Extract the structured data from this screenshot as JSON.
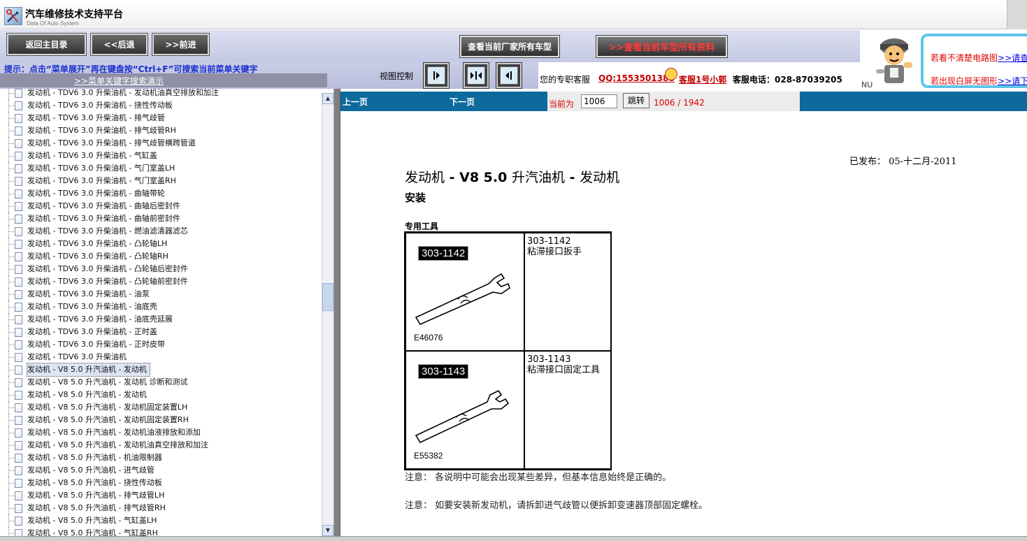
{
  "app": {
    "title": "汽车维修技术支持平台",
    "subtitle": "Data Of Auto System"
  },
  "toolbar": {
    "home_label": "返回主目录",
    "back_label": "<<后退",
    "forward_label": ">>前进",
    "all_models_label": "查看当前厂家所有车型",
    "current_model_label": ">>查看当前车型所有资料"
  },
  "hint": {
    "text": "提示：点击“菜单展开”再在键盘按“Ctrl+F”可搜索当前菜单关键字",
    "link": ">>菜单关键字搜索演示"
  },
  "view_control": {
    "label": "视图控制"
  },
  "support": {
    "label": "您的专职客服",
    "qq": "QQ:1553501388",
    "agent": "客服1号小郭",
    "phone": "客服电话：028-87039205"
  },
  "promo": {
    "nu": "NU",
    "line1": "若看不清楚电路图",
    "line1_link": ">>请查",
    "line2": "若出现白屏无图形",
    "line2_link": ">>请下"
  },
  "tree": {
    "items": [
      {
        "label": "发动机 - TDV6 3.0 升柴油机 - 发动机油真空排放和加注"
      },
      {
        "label": "发动机 - TDV6 3.0 升柴油机 - 挠性传动板"
      },
      {
        "label": "发动机 - TDV6 3.0 升柴油机 - 排气歧管"
      },
      {
        "label": "发动机 - TDV6 3.0 升柴油机 - 排气歧管RH"
      },
      {
        "label": "发动机 - TDV6 3.0 升柴油机 - 排气歧管横跨管道"
      },
      {
        "label": "发动机 - TDV6 3.0 升柴油机 - 气缸盖"
      },
      {
        "label": "发动机 - TDV6 3.0 升柴油机 - 气门室盖LH"
      },
      {
        "label": "发动机 - TDV6 3.0 升柴油机 - 气门室盖RH"
      },
      {
        "label": "发动机 - TDV6 3.0 升柴油机 - 曲轴带轮"
      },
      {
        "label": "发动机 - TDV6 3.0 升柴油机 - 曲轴后密封件"
      },
      {
        "label": "发动机 - TDV6 3.0 升柴油机 - 曲轴前密封件"
      },
      {
        "label": "发动机 - TDV6 3.0 升柴油机 - 燃油滤清器滤芯"
      },
      {
        "label": "发动机 - TDV6 3.0 升柴油机 - 凸轮轴LH"
      },
      {
        "label": "发动机 - TDV6 3.0 升柴油机 - 凸轮轴RH"
      },
      {
        "label": "发动机 - TDV6 3.0 升柴油机 - 凸轮轴后密封件"
      },
      {
        "label": "发动机 - TDV6 3.0 升柴油机 - 凸轮轴前密封件"
      },
      {
        "label": "发动机 - TDV6 3.0 升柴油机 - 油泵"
      },
      {
        "label": "发动机 - TDV6 3.0 升柴油机 - 油底壳"
      },
      {
        "label": "发动机 - TDV6 3.0 升柴油机 - 油底壳延展"
      },
      {
        "label": "发动机 - TDV6 3.0 升柴油机 - 正时盖"
      },
      {
        "label": "发动机 - TDV6 3.0 升柴油机 - 正时皮带"
      },
      {
        "label": "发动机 - TDV6 3.0 升柴油机"
      },
      {
        "label": "发动机 - V8 5.0 升汽油机 - 发动机",
        "selected": true
      },
      {
        "label": "发动机 - V8 5.0 升汽油机 - 发动机 诊断和测试"
      },
      {
        "label": "发动机 - V8 5.0 升汽油机 - 发动机"
      },
      {
        "label": "发动机 - V8 5.0 升汽油机 - 发动机固定装置LH"
      },
      {
        "label": "发动机 - V8 5.0 升汽油机 - 发动机固定装置RH"
      },
      {
        "label": "发动机 - V8 5.0 升汽油机 - 发动机油液排放和添加"
      },
      {
        "label": "发动机 - V8 5.0 升汽油机 - 发动机油真空排放和加注"
      },
      {
        "label": "发动机 - V8 5.0 升汽油机 - 机油限制器"
      },
      {
        "label": "发动机 - V8 5.0 升汽油机 - 进气歧管"
      },
      {
        "label": "发动机 - V8 5.0 升汽油机 - 挠性传动板"
      },
      {
        "label": "发动机 - V8 5.0 升汽油机 - 排气歧管LH"
      },
      {
        "label": "发动机 - V8 5.0 升汽油机 - 排气歧管RH"
      },
      {
        "label": "发动机 - V8 5.0 升汽油机 - 气缸盖LH"
      },
      {
        "label": "发动机 - V8 5.0 升汽油机 - 气缸盖RH"
      }
    ]
  },
  "pager": {
    "prev_label": "上一页",
    "next_label": "下一页",
    "current_label": "当前为",
    "current_value": "1006",
    "go_label": "跳转",
    "count": "1006 / 1942"
  },
  "doc": {
    "published": "已发布：  05-十二月-2011",
    "title_prefix": "发动机",
    "title_bold": " - V8 5.0 ",
    "title_mid": "升汽油机",
    "title_bold2": " - ",
    "title_end": "发动机",
    "subtitle": "安装",
    "tools_heading": "专用工具",
    "tools": [
      {
        "part": "303-1142",
        "ecode": "E46076",
        "number": "303-1142",
        "name": "粘滞接口扳手"
      },
      {
        "part": "303-1143",
        "ecode": "E55382",
        "number": "303-1143",
        "name": "粘滞接口固定工具"
      }
    ],
    "note1": "注意：  各说明中可能会出现某些差异，但基本信息始终是正确的。",
    "note2": "注意：  如要安装新发动机，请拆卸进气歧管以便拆卸变速器顶部固定螺栓。"
  }
}
